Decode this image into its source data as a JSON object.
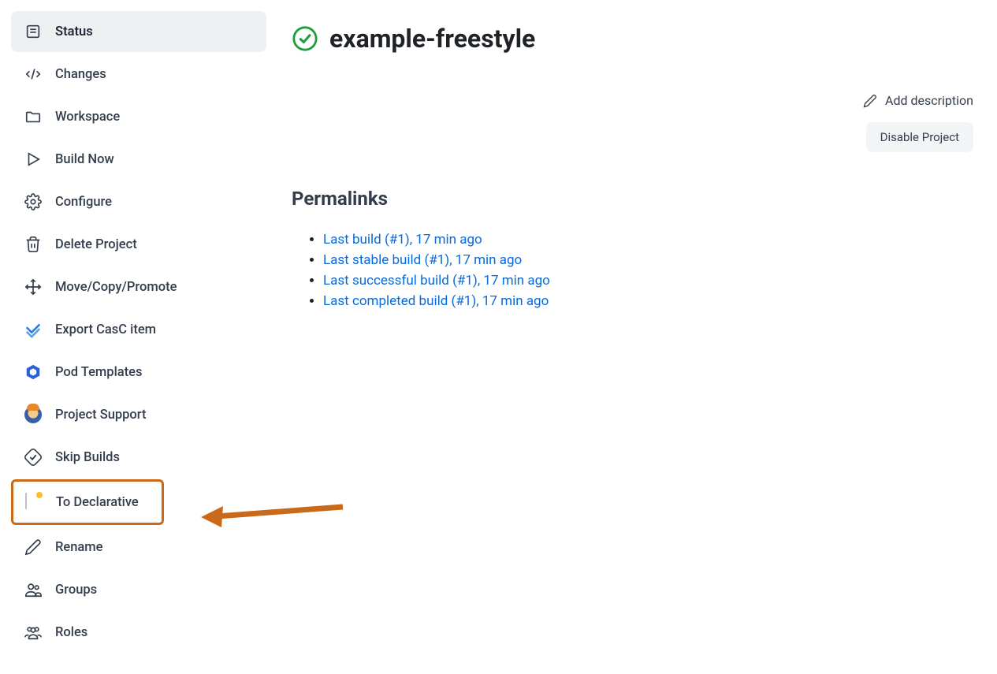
{
  "project": {
    "title": "example-freestyle"
  },
  "actions": {
    "add_description": "Add description",
    "disable_project": "Disable Project"
  },
  "sidebar": {
    "items": [
      {
        "label": "Status"
      },
      {
        "label": "Changes"
      },
      {
        "label": "Workspace"
      },
      {
        "label": "Build Now"
      },
      {
        "label": "Configure"
      },
      {
        "label": "Delete Project"
      },
      {
        "label": "Move/Copy/Promote"
      },
      {
        "label": "Export CasC item"
      },
      {
        "label": "Pod Templates"
      },
      {
        "label": "Project Support"
      },
      {
        "label": "Skip Builds"
      },
      {
        "label": "To Declarative"
      },
      {
        "label": "Rename"
      },
      {
        "label": "Groups"
      },
      {
        "label": "Roles"
      }
    ]
  },
  "permalinks": {
    "title": "Permalinks",
    "links": [
      {
        "text": "Last build (#1), 17 min ago"
      },
      {
        "text": "Last stable build (#1), 17 min ago"
      },
      {
        "text": "Last successful build (#1), 17 min ago"
      },
      {
        "text": "Last completed build (#1), 17 min ago"
      }
    ]
  }
}
